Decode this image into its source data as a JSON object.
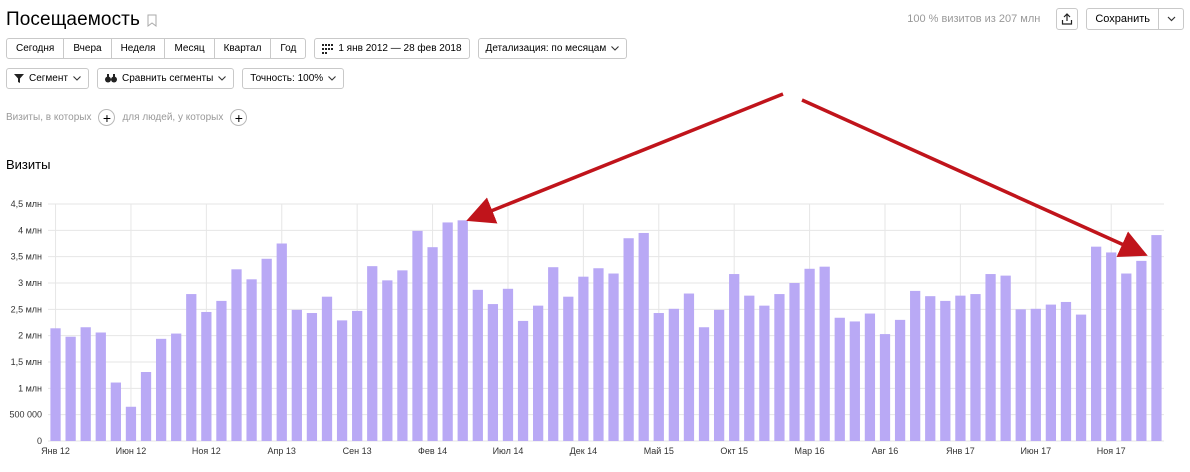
{
  "header": {
    "title": "Посещаемость",
    "visits_note": "100 % визитов из 207 млн",
    "save_label": "Сохранить"
  },
  "period_tabs": [
    "Сегодня",
    "Вчера",
    "Неделя",
    "Месяц",
    "Квартал",
    "Год"
  ],
  "date_range": "1 янв 2012 — 28 фев 2018",
  "detail_label": "Детализация: по месяцам",
  "segment_label": "Сегмент",
  "compare_label": "Сравнить сегменты",
  "accuracy_label": "Точность: 100%",
  "filter": {
    "visits_where": "Визиты, в которых",
    "people_where": "для людей, у которых"
  },
  "colors": {
    "bar": "#b9a9f5",
    "arrow": "#c0141b",
    "grid": "#e6e6e6"
  },
  "chart_data": {
    "type": "bar",
    "title": "Визиты",
    "ylim": [
      0,
      4500000
    ],
    "y_ticks": [
      {
        "v": 0,
        "label": "0"
      },
      {
        "v": 500000,
        "label": "500 000"
      },
      {
        "v": 1000000,
        "label": "1 млн"
      },
      {
        "v": 1500000,
        "label": "1,5 млн"
      },
      {
        "v": 2000000,
        "label": "2 млн"
      },
      {
        "v": 2500000,
        "label": "2,5 млн"
      },
      {
        "v": 3000000,
        "label": "3 млн"
      },
      {
        "v": 3500000,
        "label": "3,5 млн"
      },
      {
        "v": 4000000,
        "label": "4 млн"
      },
      {
        "v": 4500000,
        "label": "4,5 млн"
      }
    ],
    "x_ticks": [
      {
        "i": 0,
        "label": "Янв 12"
      },
      {
        "i": 5,
        "label": "Июн 12"
      },
      {
        "i": 10,
        "label": "Ноя 12"
      },
      {
        "i": 15,
        "label": "Апр 13"
      },
      {
        "i": 20,
        "label": "Сен 13"
      },
      {
        "i": 25,
        "label": "Фев 14"
      },
      {
        "i": 30,
        "label": "Июл 14"
      },
      {
        "i": 35,
        "label": "Дек 14"
      },
      {
        "i": 40,
        "label": "Май 15"
      },
      {
        "i": 45,
        "label": "Окт 15"
      },
      {
        "i": 50,
        "label": "Мар 16"
      },
      {
        "i": 55,
        "label": "Авг 16"
      },
      {
        "i": 60,
        "label": "Янв 17"
      },
      {
        "i": 65,
        "label": "Июн 17"
      },
      {
        "i": 70,
        "label": "Ноя 17"
      }
    ],
    "values": [
      2140000,
      1980000,
      2160000,
      2060000,
      1110000,
      650000,
      1310000,
      1940000,
      2040000,
      2790000,
      2450000,
      2660000,
      3260000,
      3070000,
      3460000,
      3750000,
      2490000,
      2430000,
      2740000,
      2290000,
      2470000,
      3320000,
      3050000,
      3240000,
      3990000,
      3680000,
      4150000,
      4190000,
      2870000,
      2600000,
      2890000,
      2280000,
      2570000,
      3300000,
      2740000,
      3120000,
      3280000,
      3180000,
      3850000,
      3950000,
      2430000,
      2510000,
      2800000,
      2160000,
      2490000,
      3170000,
      2760000,
      2570000,
      2790000,
      3000000,
      3270000,
      3310000,
      2340000,
      2270000,
      2420000,
      2030000,
      2300000,
      2850000,
      2750000,
      2660000,
      2760000,
      2790000,
      3170000,
      3140000,
      2500000,
      2510000,
      2590000,
      2640000,
      2400000,
      3690000,
      3580000,
      3180000,
      3420000,
      3910000
    ]
  }
}
